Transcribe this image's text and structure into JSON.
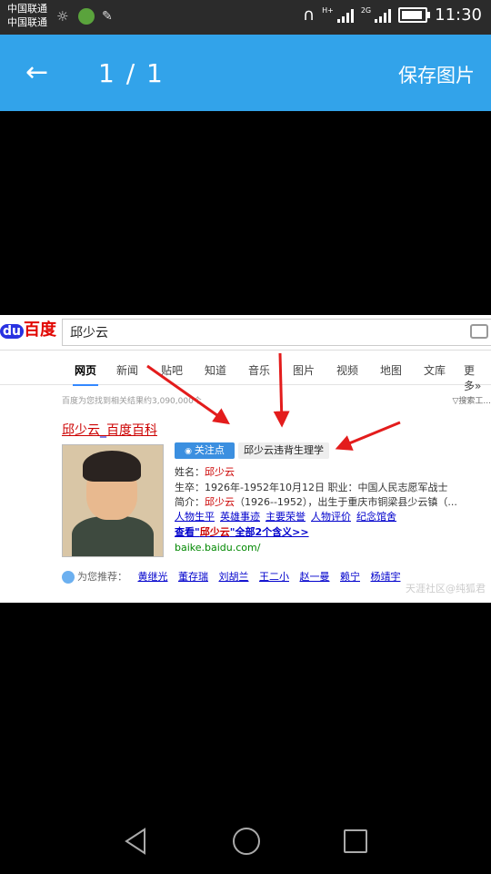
{
  "status_bar": {
    "carrier_1": "中国联通",
    "carrier_2": "中国联通",
    "network_1": "H+",
    "network_2": "2G",
    "time": "11:30"
  },
  "app_bar": {
    "counter": "1 / 1",
    "save_label": "保存图片"
  },
  "image": {
    "search_query": "邱少云",
    "logo_text": "百度",
    "tabs": [
      "网页",
      "新闻",
      "贴吧",
      "知道",
      "音乐",
      "图片",
      "视频",
      "地图",
      "文库",
      "更多»"
    ],
    "result_count": "百度为您找到相关结果约3,090,000个",
    "tools": "▽搜索工...",
    "result_title_name": "邱少云",
    "result_title_sep": "_",
    "result_title_site": "百度百科",
    "follow_label": "关注点",
    "violation_tag": "邱少云违背生理学",
    "name_label": "姓名：",
    "name_value": "邱少云",
    "dates_line": "生卒：1926年-1952年10月12日   职业：中国人民志愿军战士",
    "intro_label": "简介：",
    "intro_name": "邱少云",
    "intro_rest": "（1926--1952），出生于重庆市铜梁县少云镇（...",
    "links": [
      "人物生平",
      "英雄事迹",
      "主要荣誉",
      "人物评价",
      "纪念馆舍"
    ],
    "more_prefix": "查看\"",
    "more_name": "邱少云",
    "more_suffix": "\"全部2个含义>>",
    "url": "baike.baidu.com/",
    "recommend_label": "为您推荐：",
    "recommend": [
      "黄继光",
      "董存瑞",
      "刘胡兰",
      "王二小",
      "赵一曼",
      "赖宁",
      "杨靖宇"
    ],
    "watermark": "天涯社区@纯狐君"
  },
  "nav_bar": {
    "icons": [
      "back-triangle-icon",
      "home-circle-icon",
      "recents-square-icon"
    ]
  }
}
